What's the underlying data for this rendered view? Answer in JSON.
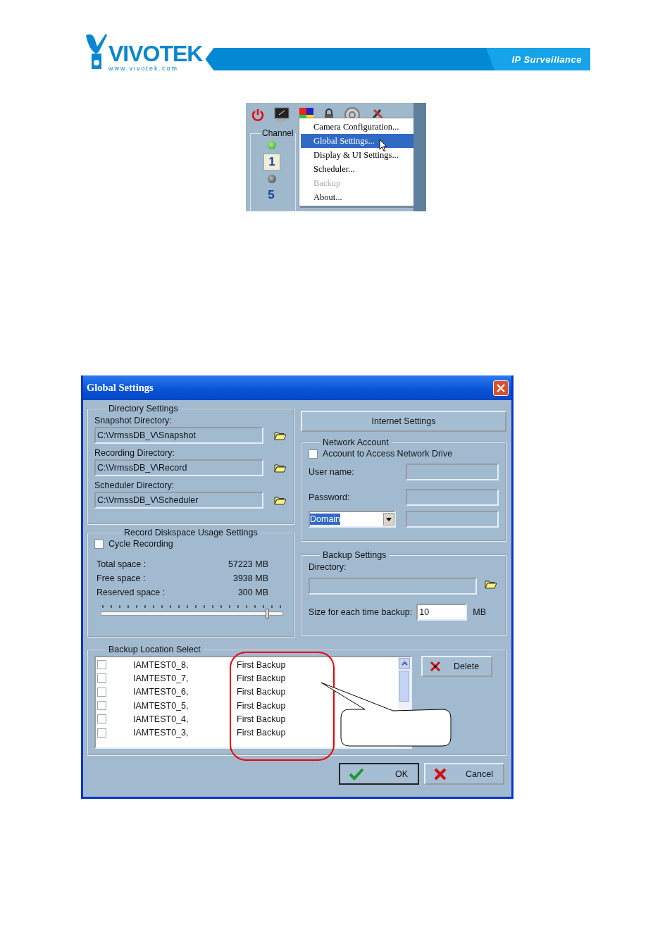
{
  "header": {
    "logo": "VIVOTEK",
    "url": "www.vivotek.com",
    "tagline": "IP Surveillance"
  },
  "app": {
    "channel_legend": "Channel",
    "channels": [
      {
        "number": "1",
        "on": true,
        "selected": true
      },
      {
        "number": "5",
        "on": false,
        "selected": false
      }
    ],
    "menu": [
      {
        "label": "Camera Configuration...",
        "selected": false,
        "disabled": false
      },
      {
        "label": "Global Settings...",
        "selected": true,
        "disabled": false
      },
      {
        "label": "Display & UI Settings...",
        "selected": false,
        "disabled": false
      },
      {
        "label": "Scheduler...",
        "selected": false,
        "disabled": false
      },
      {
        "label": "Backup",
        "selected": false,
        "disabled": true
      },
      {
        "label": "About...",
        "selected": false,
        "disabled": false
      }
    ]
  },
  "dialog": {
    "title": "Global Settings",
    "directory": {
      "legend": "Directory Settings",
      "fields": [
        {
          "label": "Snapshot Directory:",
          "value": "C:\\VrmssDB_V\\Snapshot"
        },
        {
          "label": "Recording Directory:",
          "value": "C:\\VrmssDB_V\\Record"
        },
        {
          "label": "Scheduler Directory:",
          "value": "C:\\VrmssDB_V\\Scheduler"
        }
      ]
    },
    "disk": {
      "legend": "Record Diskspace Usage Settings",
      "cycle": {
        "label": "Cycle Recording",
        "checked": false
      },
      "stats": [
        {
          "label": "Total space :",
          "value": "57223 MB"
        },
        {
          "label": "Free space :",
          "value": "3938 MB"
        },
        {
          "label": "Reserved space :",
          "value": "300 MB"
        }
      ],
      "slider": {
        "level": 0.92
      }
    },
    "internet_button": "Internet Settings",
    "network": {
      "legend": "Network Account",
      "account": {
        "label": "Account to Access Network Drive",
        "checked": false
      },
      "user_label": "User name:",
      "password_label": "Password:",
      "domain": "Domain"
    },
    "backup": {
      "legend": "Backup Settings",
      "directory_label": "Directory:",
      "size_label": "Size for each time backup:",
      "size_value": "10",
      "size_unit": "MB"
    },
    "location": {
      "legend": "Backup Location Select",
      "rows": [
        {
          "name": "IAMTEST0_8,",
          "note": "First Backup",
          "checked": false
        },
        {
          "name": "IAMTEST0_7,",
          "note": "First Backup",
          "checked": false
        },
        {
          "name": "IAMTEST0_6,",
          "note": "First Backup",
          "checked": false
        },
        {
          "name": "IAMTEST0_5,",
          "note": "First Backup",
          "checked": false
        },
        {
          "name": "IAMTEST0_4,",
          "note": "First Backup",
          "checked": false
        },
        {
          "name": "IAMTEST0_3,",
          "note": "First Backup",
          "checked": false
        }
      ],
      "delete_button": "Delete"
    },
    "ok_button": "OK",
    "cancel_button": "Cancel"
  }
}
